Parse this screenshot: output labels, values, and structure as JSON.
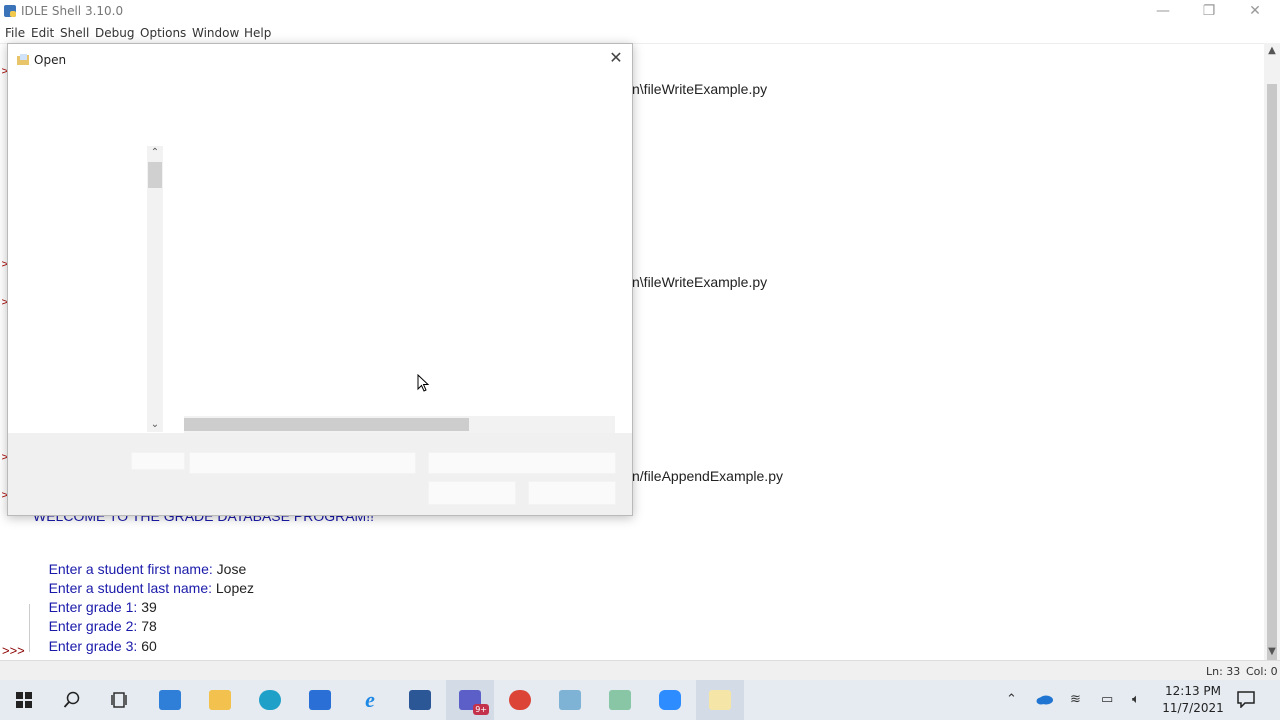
{
  "window": {
    "title": "IDLE Shell 3.10.0",
    "controls": {
      "minimize": "—",
      "maximize": "❐",
      "close": "✕"
    }
  },
  "menu": [
    "File",
    "Edit",
    "Shell",
    "Debug",
    "Options",
    "Window",
    "Help"
  ],
  "shell": {
    "path_lines": [
      "n\\fileWriteExample.py",
      "n\\fileWriteExample.py",
      "n/fileAppendExample.py"
    ],
    "welcome_partial": "WELCOME TO THE GRADE DATABASE PROGRAM!!",
    "io_lines": [
      {
        "prompt": "Enter a student first name: ",
        "value": "Jose"
      },
      {
        "prompt": "Enter a student last name: ",
        "value": "Lopez"
      },
      {
        "prompt": "Enter grade 1: ",
        "value": "39"
      },
      {
        "prompt": "Enter grade 2: ",
        "value": "78"
      },
      {
        "prompt": "Enter grade 3: ",
        "value": "60"
      }
    ],
    "prompt": ">>>"
  },
  "status": {
    "line": "Ln: 33",
    "col": "Col: 0"
  },
  "dialog": {
    "title": "Open",
    "close": "✕"
  },
  "clock": {
    "time": "12:13 PM",
    "date": "11/7/2021"
  },
  "taskbar": {
    "icons": [
      "start-icon",
      "search-icon",
      "task-view-icon",
      "store-icon",
      "file-explorer-icon",
      "edge-icon",
      "calculator-icon",
      "ie-icon",
      "word-icon",
      "teams-icon",
      "chrome-icon",
      "notepad-icon",
      "paint-icon",
      "zoom-icon",
      "idle-icon"
    ],
    "teams_badge": "9+"
  },
  "colors": {
    "prompt_blue": "#1a1aaa",
    "prompt_red": "#8a0000"
  }
}
